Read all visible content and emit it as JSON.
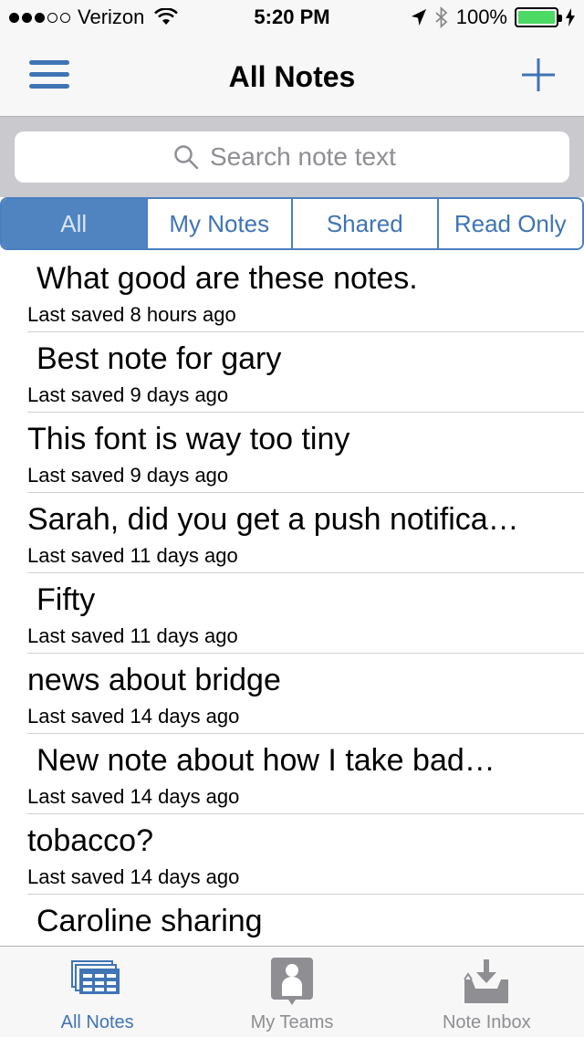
{
  "status": {
    "carrier": "Verizon",
    "time": "5:20 PM",
    "battery": "100%",
    "battery_level": 1.0,
    "battery_color": "#4cd964"
  },
  "nav": {
    "title": "All Notes",
    "menu_icon": "hamburger-menu-icon",
    "add_icon": "plus-icon"
  },
  "search": {
    "placeholder": "Search note text",
    "value": ""
  },
  "segments": {
    "items": [
      "All",
      "My Notes",
      "Shared",
      "Read Only"
    ],
    "selected": "All"
  },
  "notes": [
    {
      "title": "What good are these notes.",
      "meta": "Last saved 8 hours ago"
    },
    {
      "title": "Best note for gary",
      "meta": "Last saved 9 days ago"
    },
    {
      "title": "This font is way too tiny",
      "meta": "Last saved 9 days ago"
    },
    {
      "title": "Sarah, did you get a push notifica…",
      "meta": "Last saved 11 days ago"
    },
    {
      "title": "Fifty",
      "meta": "Last saved 11 days ago"
    },
    {
      "title": "news about bridge",
      "meta": "Last saved 14 days ago"
    },
    {
      "title": "New note about how I take bad…",
      "meta": "Last saved 14 days ago"
    },
    {
      "title": "tobacco?",
      "meta": "Last saved 14 days ago"
    },
    {
      "title": "Caroline sharing",
      "meta": ""
    }
  ],
  "tabs": [
    {
      "label": "All Notes",
      "icon": "notes-stack-icon",
      "active": true
    },
    {
      "label": "My Teams",
      "icon": "person-badge-icon",
      "active": false
    },
    {
      "label": "Note Inbox",
      "icon": "inbox-tray-icon",
      "active": false
    }
  ],
  "colors": {
    "accent": "#3f74b5",
    "segment_active": "#4f84c1",
    "tab_inactive": "#8e8e93"
  }
}
